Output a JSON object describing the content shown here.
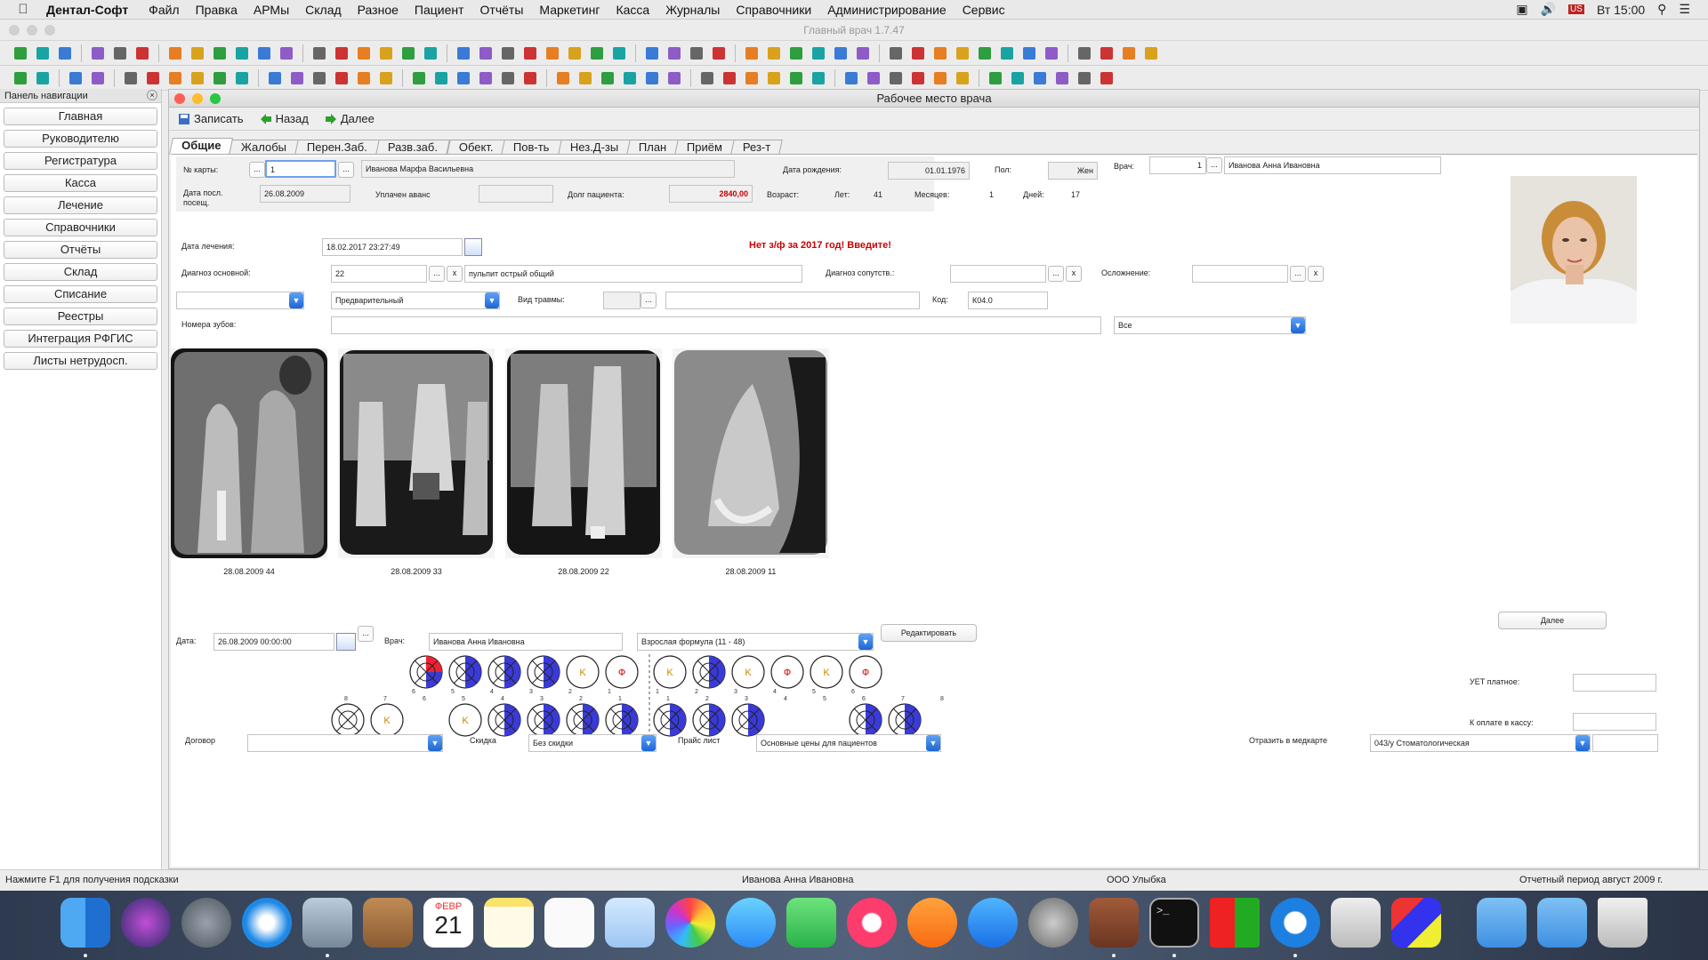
{
  "menubar": {
    "app_name": "Дентал-Софт",
    "items": [
      "Файл",
      "Правка",
      "АРМы",
      "Склад",
      "Разное",
      "Пациент",
      "Отчёты",
      "Маркетинг",
      "Касса",
      "Журналы",
      "Справочники",
      "Администрирование",
      "Сервис"
    ],
    "clock": "Вт 15:00"
  },
  "window": {
    "title": "Главный врач 1.7.47"
  },
  "nav": {
    "title": "Панель навигации",
    "items": [
      "Главная",
      "Руководителю",
      "Регистратура",
      "Касса",
      "Лечение",
      "Справочники",
      "Отчёты",
      "Склад",
      "Списание",
      "Реестры",
      "Интеграция РФГИС",
      "Листы нетрудосп."
    ]
  },
  "workspace": {
    "title": "Рабочее место врача",
    "actions": {
      "save": "Записать",
      "back": "Назад",
      "next": "Далее"
    },
    "tabs": [
      "Общие",
      "Жалобы",
      "Перен.Заб.",
      "Разв.заб.",
      "Обект.",
      "Пов-ть",
      "Нез.Д-зы",
      "План",
      "Приём",
      "Рез-т"
    ]
  },
  "patient": {
    "card_label": "№ карты:",
    "card_value": "1",
    "name": "Иванова Марфа Васильевна",
    "birth_label": "Дата рождения:",
    "birth_value": "01.01.1976",
    "sex_label": "Пол:",
    "sex_value": "Жен",
    "last_visit_label": "Дата посл. посещ.",
    "last_visit_value": "26.08.2009",
    "advance_label": "Уплачен аванс",
    "advance_value": "",
    "debt_label": "Долг пациента:",
    "debt_value": "2840,00",
    "age_label": "Возраст:",
    "years_label": "Лет:",
    "years_value": "41",
    "months_label": "Месяцев:",
    "months_value": "1",
    "days_label": "Дней:",
    "days_value": "17"
  },
  "doctor": {
    "label": "Врач:",
    "id": "1",
    "name": "Иванова Анна Ивановна"
  },
  "treatment": {
    "date_label": "Дата лечения:",
    "date_value": "18.02.2017 23:27:49",
    "warning": "Нет з/ф за 2017 год! Введите!",
    "diag_main_label": "Диагноз основной:",
    "diag_main_code": "22",
    "diag_main_text": "пульпит острый общий",
    "diag_sub_label": "Диагноз сопутств.:",
    "complication_label": "Осложнение:",
    "status_value": "Предварительный",
    "trauma_label": "Вид травмы:",
    "code_label": "Код:",
    "code_value": "К04.0",
    "teeth_label": "Номера зубов:",
    "teeth_filter": "Все"
  },
  "xrays": [
    {
      "caption": "28.08.2009 44"
    },
    {
      "caption": "28.08.2009 33"
    },
    {
      "caption": "28.08.2009 22"
    },
    {
      "caption": "28.08.2009 11"
    }
  ],
  "formula": {
    "date_label": "Дата:",
    "date_value": "26.08.2009 00:00:00",
    "doctor_label": "Врач:",
    "doctor_value": "Иванова Анна Ивановна",
    "formula_type": "Взрослая формула (11 - 48)",
    "edit_button": "Редактировать",
    "next_button": "Далее",
    "upper_numbers": [
      "6",
      "5",
      "4",
      "3",
      "2",
      "1",
      "1",
      "2",
      "3",
      "4",
      "5",
      "6"
    ],
    "lower_numbers": [
      "8",
      "7",
      "6",
      "5",
      "4",
      "3",
      "2",
      "1",
      "1",
      "2",
      "3",
      "4",
      "5",
      "6",
      "7",
      "8"
    ],
    "uet_label": "УЕТ платное:",
    "uet_value": "",
    "pay_label": "К оплате в кассу:",
    "pay_value": "",
    "contract_label": "Договор",
    "contract_value": "",
    "discount_label": "Скидка",
    "discount_value": "Без скидки",
    "price_label": "Прайс лист",
    "price_value": "Основные цены для пациентов",
    "medcard_label": "Отразить в медкарте",
    "medcard_value": "043/у Стоматологическая"
  },
  "statusbar": {
    "hint": "Нажмите F1 для получения подсказки",
    "user": "Иванова Анна Ивановна",
    "org": "ООО Улыбка",
    "period": "Отчетный период август 2009 г."
  },
  "dock": {
    "calendar_month": "ФЕВР",
    "calendar_day": "21"
  }
}
